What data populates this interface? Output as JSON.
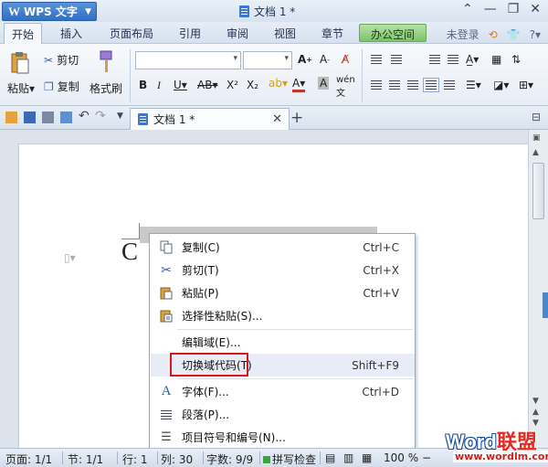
{
  "title_bar": {
    "app_name": "WPS 文字",
    "doc_title": "文档 1 *",
    "controls": [
      "chevron-up-icon",
      "minimize-icon",
      "restore-icon",
      "close-icon"
    ]
  },
  "menu": {
    "tabs": [
      "开始",
      "插入",
      "页面布局",
      "引用",
      "审阅",
      "视图",
      "章节"
    ],
    "active_tab": "开始",
    "office_tab": "办公空间",
    "login": "未登录"
  },
  "ribbon": {
    "cut": "剪切",
    "paste": "粘贴",
    "copy": "复制",
    "format_painter": "格式刷",
    "font_name": "",
    "font_size": ""
  },
  "doc_tab": {
    "title": "文档 1 *"
  },
  "document": {
    "text": "C"
  },
  "context_menu": {
    "items": [
      {
        "label": "复制(C)",
        "shortcut": "Ctrl+C",
        "icon": "copy-icon"
      },
      {
        "label": "剪切(T)",
        "shortcut": "Ctrl+X",
        "icon": "scissors-icon"
      },
      {
        "label": "粘贴(P)",
        "shortcut": "Ctrl+V",
        "icon": "paste-icon"
      },
      {
        "label": "选择性粘贴(S)...",
        "shortcut": "",
        "icon": "paste-special-icon"
      },
      {
        "label": "编辑域(E)...",
        "shortcut": "",
        "icon": ""
      },
      {
        "label": "切换域代码(T)",
        "shortcut": "Shift+F9",
        "icon": ""
      },
      {
        "label": "字体(F)...",
        "shortcut": "Ctrl+D",
        "icon": "font-icon"
      },
      {
        "label": "段落(P)...",
        "shortcut": "",
        "icon": "paragraph-icon"
      },
      {
        "label": "项目符号和编号(N)...",
        "shortcut": "",
        "icon": "list-icon"
      }
    ],
    "highlighted": "切换域代码(T)"
  },
  "status_bar": {
    "page": "页面: 1/1",
    "section": "节: 1/1",
    "line": "行: 1",
    "column": "列: 30",
    "word_count": "字数: 9/9",
    "spell_check": "拼写检查",
    "zoom": "100 %"
  },
  "watermark": {
    "word": "Word",
    "cn": "联盟",
    "url": "www.wordlm.com"
  },
  "colors": {
    "accent": "#2f6fc5",
    "highlight_box": "#d6191b",
    "office_tab": "#7cc46a"
  }
}
